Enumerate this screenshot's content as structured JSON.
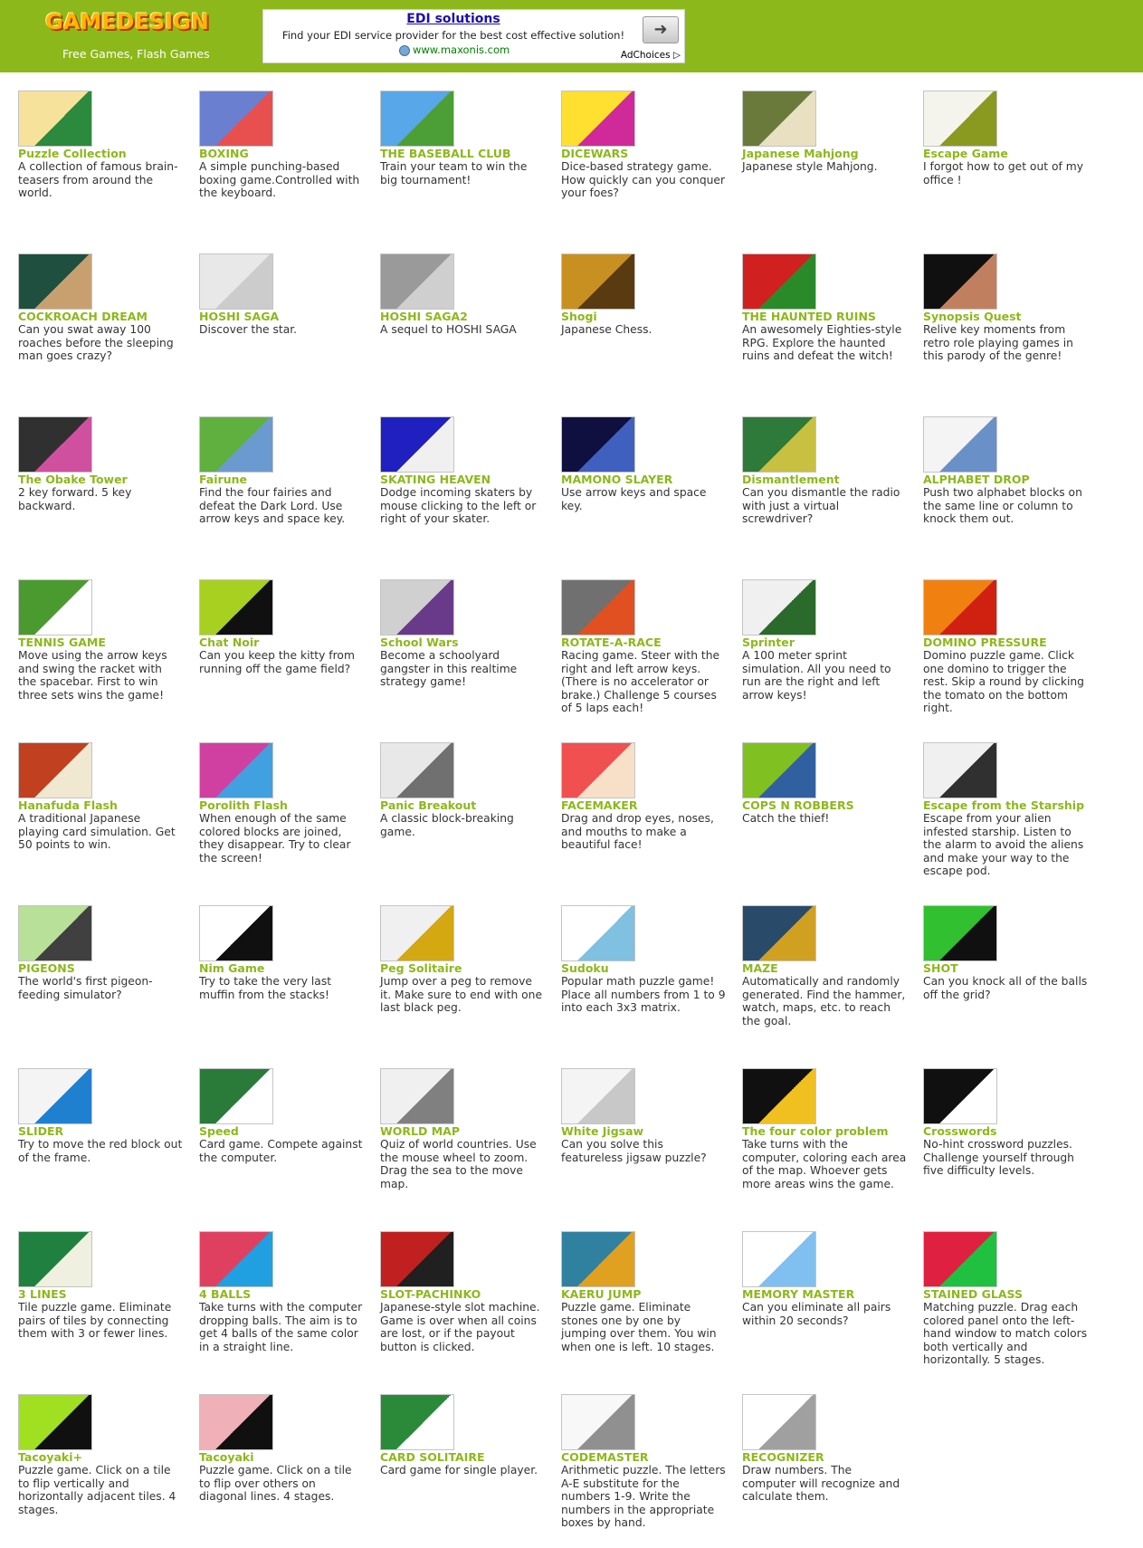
{
  "header": {
    "logo_text": "GAMEDESIGN",
    "tagline": "Free Games, Flash Games",
    "background": "#8db81b"
  },
  "ad": {
    "title": "EDI solutions",
    "description": "Find your EDI service provider for the best cost effective solution!",
    "url": "www.maxonis.com",
    "button_icon": "arrow-right-icon",
    "choices_label": "AdChoices"
  },
  "accent_color": "#8db81b",
  "games": [
    {
      "title": "Puzzle Collection",
      "desc": "A collection of famous brain-teasers from around the world.",
      "c1": "#f7e29b",
      "c2": "#2b8a3e"
    },
    {
      "title": "BOXING",
      "desc": "A simple punching-based boxing game.Controlled with the keyboard.",
      "c1": "#6b7fd0",
      "c2": "#e85050"
    },
    {
      "title": "THE BASEBALL CLUB",
      "desc": "Train your team to win the big tournament!",
      "c1": "#58a7e8",
      "c2": "#4b9f35"
    },
    {
      "title": "DICEWARS",
      "desc": "Dice-based strategy game. How quickly can you conquer your foes?",
      "c1": "#ffe030",
      "c2": "#d02a9a"
    },
    {
      "title": "Japanese Mahjong",
      "desc": "Japanese style Mahjong.",
      "c1": "#6a7a3a",
      "c2": "#e8e0c0"
    },
    {
      "title": "Escape Game",
      "desc": "I forgot how to get out of my office !",
      "c1": "#f4f4ec",
      "c2": "#8a9a20"
    },
    {
      "title": "COCKROACH DREAM",
      "desc": "Can you swat away 100 roaches before the sleeping man goes crazy?",
      "c1": "#1f4f3f",
      "c2": "#c8a070"
    },
    {
      "title": "HOSHI SAGA",
      "desc": "Discover the star.",
      "c1": "#e8e8e8",
      "c2": "#cccccc"
    },
    {
      "title": "HOSHI SAGA2",
      "desc": "A sequel to HOSHI SAGA",
      "c1": "#9a9a9a",
      "c2": "#cfcfcf"
    },
    {
      "title": "Shogi",
      "desc": "Japanese Chess.",
      "c1": "#c89020",
      "c2": "#5a3a10"
    },
    {
      "title": "THE HAUNTED RUINS",
      "desc": "An awesomely Eighties-style RPG. Explore the haunted ruins and defeat the witch!",
      "c1": "#d02020",
      "c2": "#2a8a2a"
    },
    {
      "title": "Synopsis Quest",
      "desc": "Relive key moments from retro role playing games in this parody of the genre!",
      "c1": "#101010",
      "c2": "#c08060"
    },
    {
      "title": "The Obake Tower",
      "desc": "2 key forward. 5 key backward.",
      "c1": "#303030",
      "c2": "#d050a0"
    },
    {
      "title": "Fairune",
      "desc": "Find the four fairies and defeat the Dark Lord. Use arrow keys and space key.",
      "c1": "#60b040",
      "c2": "#6a9ad0"
    },
    {
      "title": "SKATING HEAVEN",
      "desc": "Dodge incoming skaters by mouse clicking to the left or right of your skater.",
      "c1": "#2020c0",
      "c2": "#f0f0f0"
    },
    {
      "title": "MAMONO SLAYER",
      "desc": "Use arrow keys and space key.",
      "c1": "#101040",
      "c2": "#4060c0"
    },
    {
      "title": "Dismantlement",
      "desc": "Can you dismantle the radio with just a virtual screwdriver?",
      "c1": "#2e7a3a",
      "c2": "#c8c040"
    },
    {
      "title": "ALPHABET DROP",
      "desc": "Push two alphabet blocks on the same line or column to knock them out.",
      "c1": "#f4f4f4",
      "c2": "#6a90c8"
    },
    {
      "title": "TENNIS GAME",
      "desc": "Move using the arrow keys and swing the racket with the spacebar. First to win three sets wins the game!",
      "c1": "#4a9a30",
      "c2": "#ffffff"
    },
    {
      "title": "Chat Noir",
      "desc": "Can you keep the kitty from running off the game field?",
      "c1": "#a8d020",
      "c2": "#101010"
    },
    {
      "title": "School Wars",
      "desc": "Become a schoolyard gangster in this realtime strategy game!",
      "c1": "#d0d0d0",
      "c2": "#6a3a8a"
    },
    {
      "title": "ROTATE-A-RACE",
      "desc": "Racing game. Steer with the right and left arrow keys. (There is no accelerator or brake.) Challenge 5 courses of 5 laps each!",
      "c1": "#707070",
      "c2": "#e05020"
    },
    {
      "title": "Sprinter",
      "desc": "A 100 meter sprint simulation. All you need to run are the right and left arrow keys!",
      "c1": "#f0f0f0",
      "c2": "#2a6a2a"
    },
    {
      "title": "DOMINO PRESSURE",
      "desc": "Domino puzzle game. Click one domino to trigger the rest. Skip a round by clicking the tomato on the bottom right.",
      "c1": "#f08010",
      "c2": "#d02010"
    },
    {
      "title": "Hanafuda Flash",
      "desc": "A traditional Japanese playing card simulation. Get 50 points to win.",
      "c1": "#c04020",
      "c2": "#f0e8d0"
    },
    {
      "title": "Porolith Flash",
      "desc": "When enough of the same colored blocks are joined, they disappear. Try to clear the screen!",
      "c1": "#d040a0",
      "c2": "#40a0e0"
    },
    {
      "title": "Panic Breakout",
      "desc": "A classic block-breaking game.",
      "c1": "#e8e8e8",
      "c2": "#707070"
    },
    {
      "title": "FACEMAKER",
      "desc": "Drag and drop eyes, noses, and mouths to make a beautiful face!",
      "c1": "#f05050",
      "c2": "#f8e0c8"
    },
    {
      "title": "COPS N ROBBERS",
      "desc": "Catch the thief!",
      "c1": "#80c020",
      "c2": "#3060a0"
    },
    {
      "title": "Escape from the Starship",
      "desc": "Escape from your alien infested starship. Listen to the alarm to avoid the aliens and make your way to the escape pod.",
      "c1": "#f0f0f0",
      "c2": "#303030"
    },
    {
      "title": "PIGEONS",
      "desc": "The world's first pigeon-feeding simulator?",
      "c1": "#b8e098",
      "c2": "#404040"
    },
    {
      "title": "Nim Game",
      "desc": "Try to take the very last muffin from the stacks!",
      "c1": "#ffffff",
      "c2": "#101010"
    },
    {
      "title": "Peg Solitaire",
      "desc": "Jump over a peg to remove it. Make sure to end with one last black peg.",
      "c1": "#f0f0f0",
      "c2": "#d4a810"
    },
    {
      "title": "Sudoku",
      "desc": "Popular math puzzle game! Place all numbers from 1 to 9 into each 3x3 matrix.",
      "c1": "#ffffff",
      "c2": "#80c0e0"
    },
    {
      "title": "MAZE",
      "desc": "Automatically and randomly generated. Find the hammer, watch, maps, etc. to reach the goal.",
      "c1": "#2a4a6a",
      "c2": "#d0a020"
    },
    {
      "title": "SHOT",
      "desc": "Can you knock all of the balls off the grid?",
      "c1": "#30c030",
      "c2": "#101010"
    },
    {
      "title": "SLIDER",
      "desc": "Try to move the red block out of the frame.",
      "c1": "#f4f4f4",
      "c2": "#2080d0"
    },
    {
      "title": "Speed",
      "desc": "Card game. Compete against the computer.",
      "c1": "#2a7a3a",
      "c2": "#ffffff"
    },
    {
      "title": "WORLD MAP",
      "desc": "Quiz of world countries. Use the mouse wheel to zoom. Drag the sea to the move map.",
      "c1": "#f0f0f0",
      "c2": "#808080"
    },
    {
      "title": "White Jigsaw",
      "desc": "Can you solve this featureless jigsaw puzzle?",
      "c1": "#f4f4f4",
      "c2": "#c8c8c8"
    },
    {
      "title": "The four color problem",
      "desc": "Take turns with the computer, coloring each area of the map. Whoever gets more areas wins the game.",
      "c1": "#101010",
      "c2": "#f0c020"
    },
    {
      "title": "Crosswords",
      "desc": "No-hint crossword puzzles. Challenge yourself through five difficulty levels.",
      "c1": "#101010",
      "c2": "#ffffff"
    },
    {
      "title": "3 LINES",
      "desc": "Tile puzzle game. Eliminate pairs of tiles by connecting them with 3 or fewer lines.",
      "c1": "#208040",
      "c2": "#f0f0e0"
    },
    {
      "title": "4 BALLS",
      "desc": "Take turns with the computer dropping balls. The aim is to get 4 balls of the same color in a straight line.",
      "c1": "#e04060",
      "c2": "#20a0e0"
    },
    {
      "title": "SLOT-PACHINKO",
      "desc": "Japanese-style slot machine. Game is over when all coins are lost, or if the payout button is clicked.",
      "c1": "#c02020",
      "c2": "#202020"
    },
    {
      "title": "KAERU JUMP",
      "desc": "Puzzle game. Eliminate stones one by one by jumping over them. You win when one is left. 10 stages.",
      "c1": "#3080a0",
      "c2": "#e0a020"
    },
    {
      "title": "MEMORY MASTER",
      "desc": "Can you eliminate all pairs within 20 seconds?",
      "c1": "#ffffff",
      "c2": "#80c0f0"
    },
    {
      "title": "STAINED GLASS",
      "desc": "Matching puzzle. Drag each colored panel onto the left-hand window to match colors both vertically and horizontally. 5 stages.",
      "c1": "#e02040",
      "c2": "#20c040"
    },
    {
      "title": "Tacoyaki+",
      "desc": "Puzzle game. Click on a tile to flip vertically and horizontally adjacent tiles. 4 stages.",
      "c1": "#a0e020",
      "c2": "#101010"
    },
    {
      "title": "Tacoyaki",
      "desc": "Puzzle game. Click on a tile to flip over others on diagonal lines. 4 stages.",
      "c1": "#f0b0b8",
      "c2": "#101010"
    },
    {
      "title": "CARD SOLITAIRE",
      "desc": "Card game for single player.",
      "c1": "#2a8a3a",
      "c2": "#ffffff"
    },
    {
      "title": "CODEMASTER",
      "desc": "Arithmetic puzzle. The letters A-E substitute for the numbers 1-9. Write the numbers in the appropriate boxes by hand.",
      "c1": "#f8f8f8",
      "c2": "#909090"
    },
    {
      "title": "RECOGNIZER",
      "desc": "Draw numbers. The computer will recognize and calculate them.",
      "c1": "#ffffff",
      "c2": "#a0a0a0"
    }
  ]
}
